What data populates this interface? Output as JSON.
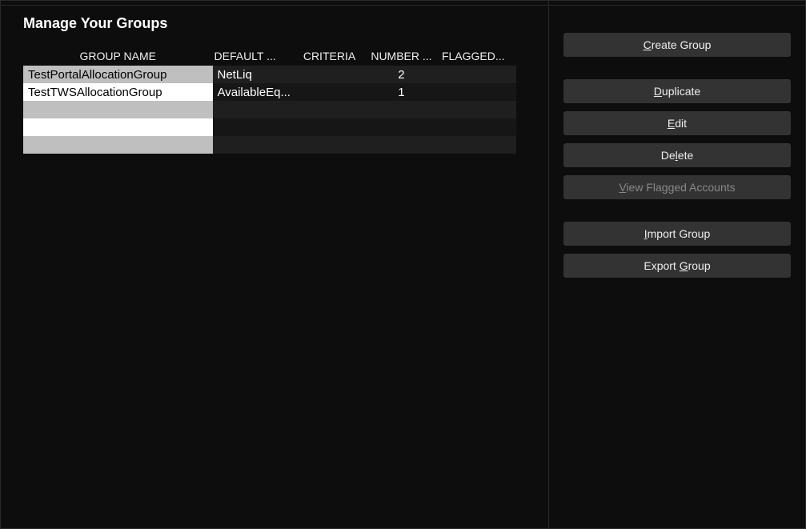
{
  "title": "Manage Your Groups",
  "table": {
    "headers": {
      "group_name": "GROUP NAME",
      "default": "DEFAULT ...",
      "criteria": "CRITERIA",
      "number": "NUMBER ...",
      "flagged": "FLAGGED..."
    },
    "rows": [
      {
        "name": "TestPortalAllocationGroup",
        "default": "NetLiq",
        "criteria": "",
        "number": "2",
        "flagged": ""
      },
      {
        "name": "TestTWSAllocationGroup",
        "default": "AvailableEq...",
        "criteria": "",
        "number": "1",
        "flagged": ""
      }
    ],
    "empty_rows": 3
  },
  "buttons": {
    "create_group": {
      "pre": "",
      "accel": "C",
      "post": "reate Group"
    },
    "duplicate": {
      "pre": "",
      "accel": "D",
      "post": "uplicate"
    },
    "edit": {
      "pre": "",
      "accel": "E",
      "post": "dit"
    },
    "delete": {
      "pre": "De",
      "accel": "l",
      "post": "ete"
    },
    "view_flagged": {
      "pre": "",
      "accel": "V",
      "post": "iew Flagged Accounts"
    },
    "import_group": {
      "pre": "",
      "accel": "I",
      "post": "mport Group"
    },
    "export_group": {
      "pre": "Export ",
      "accel": "G",
      "post": "roup"
    }
  }
}
